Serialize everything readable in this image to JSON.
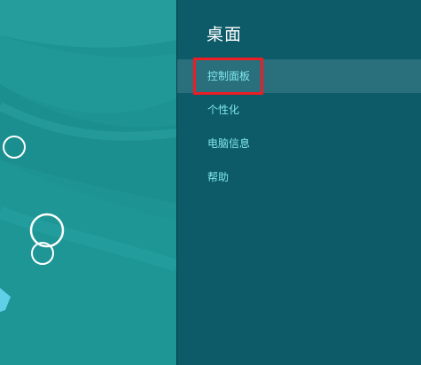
{
  "settings_panel": {
    "title": "桌面",
    "items": [
      {
        "label": "控制面板",
        "selected": true
      },
      {
        "label": "个性化",
        "selected": false
      },
      {
        "label": "电脑信息",
        "selected": false
      },
      {
        "label": "帮助",
        "selected": false
      }
    ]
  },
  "colors": {
    "desktop_bg": "#1d9393",
    "panel_bg": "#0d5a68",
    "menu_text": "#7fe6ea",
    "selected_bg": "#2a6f7c",
    "highlight_border": "#ee1c24"
  }
}
